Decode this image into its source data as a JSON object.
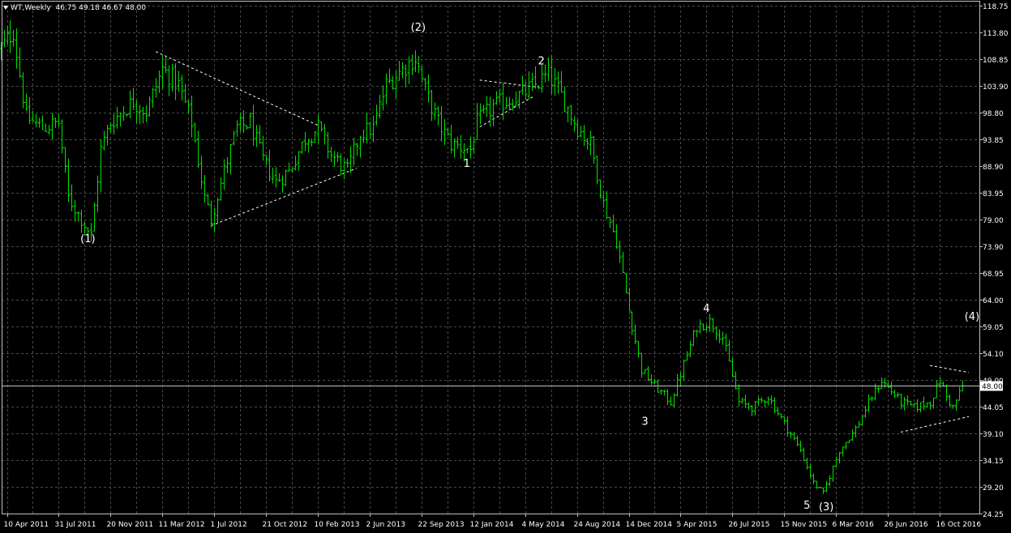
{
  "header": {
    "symbol": "WT,Weekly",
    "ohlc": "46.75 49.18 46.67 48.00"
  },
  "colors": {
    "background": "#000000",
    "grid": "#4a4a4a",
    "bars": "#00e000",
    "price_line": "#c0c0c0",
    "text": "#ffffff"
  },
  "chart_data": {
    "type": "ohlc",
    "title": "WT,Weekly",
    "last_price": 48.0,
    "last_price_label": "48.00",
    "ylim": [
      24.25,
      118.75
    ],
    "y_ticks": [
      "118.75",
      "113.80",
      "108.85",
      "103.90",
      "98.80",
      "93.85",
      "88.90",
      "83.95",
      "79.00",
      "73.90",
      "68.95",
      "64.00",
      "59.05",
      "54.10",
      "49.00",
      "44.05",
      "39.10",
      "34.15",
      "29.20",
      "24.25"
    ],
    "x_ticks": [
      "10 Apr 2011",
      "31 Jul 2011",
      "20 Nov 2011",
      "11 Mar 2012",
      "1 Jul 2012",
      "21 Oct 2012",
      "10 Feb 2013",
      "2 Jun 2013",
      "22 Sep 2013",
      "12 Jan 2014",
      "4 May 2014",
      "24 Aug 2014",
      "14 Dec 2014",
      "5 Apr 2015",
      "26 Jul 2015",
      "15 Nov 2015",
      "6 Mar 2016",
      "26 Jun 2016",
      "16 Oct 2016"
    ],
    "x_dates": [
      "2011-04-10",
      "2011-07-31",
      "2011-11-20",
      "2012-03-11",
      "2012-07-01",
      "2012-10-21",
      "2013-02-10",
      "2013-06-02",
      "2013-09-22",
      "2014-01-12",
      "2014-05-04",
      "2014-08-24",
      "2014-12-14",
      "2015-04-05",
      "2015-07-26",
      "2015-11-15",
      "2016-03-06",
      "2016-06-26",
      "2016-10-16"
    ],
    "price_path": [
      [
        "2011-03-20",
        110
      ],
      [
        "2011-04-24",
        114
      ],
      [
        "2011-05-22",
        98
      ],
      [
        "2011-06-26",
        96
      ],
      [
        "2011-07-31",
        97
      ],
      [
        "2011-08-21",
        83
      ],
      [
        "2011-09-25",
        78
      ],
      [
        "2011-10-09",
        76
      ],
      [
        "2011-10-30",
        92
      ],
      [
        "2011-11-20",
        97
      ],
      [
        "2012-01-08",
        101
      ],
      [
        "2012-02-05",
        99
      ],
      [
        "2012-03-11",
        107
      ],
      [
        "2012-04-15",
        104
      ],
      [
        "2012-05-13",
        97
      ],
      [
        "2012-06-10",
        83
      ],
      [
        "2012-06-24",
        79
      ],
      [
        "2012-07-22",
        88
      ],
      [
        "2012-08-19",
        96
      ],
      [
        "2012-09-16",
        97
      ],
      [
        "2012-10-14",
        90
      ],
      [
        "2012-11-11",
        86
      ],
      [
        "2012-12-09",
        88
      ],
      [
        "2013-01-13",
        94
      ],
      [
        "2013-02-10",
        96
      ],
      [
        "2013-03-10",
        91
      ],
      [
        "2013-04-14",
        88
      ],
      [
        "2013-05-12",
        95
      ],
      [
        "2013-06-09",
        96
      ],
      [
        "2013-07-07",
        104
      ],
      [
        "2013-08-11",
        107
      ],
      [
        "2013-09-08",
        109
      ],
      [
        "2013-09-29",
        103
      ],
      [
        "2013-10-27",
        97
      ],
      [
        "2013-11-24",
        93
      ],
      [
        "2014-01-05",
        92
      ],
      [
        "2014-01-19",
        97
      ],
      [
        "2014-02-23",
        100
      ],
      [
        "2014-03-23",
        101
      ],
      [
        "2014-04-20",
        102
      ],
      [
        "2014-05-25",
        104
      ],
      [
        "2014-06-22",
        106
      ],
      [
        "2014-07-20",
        102
      ],
      [
        "2014-08-24",
        96
      ],
      [
        "2014-09-21",
        93
      ],
      [
        "2014-10-19",
        82
      ],
      [
        "2014-11-16",
        75
      ],
      [
        "2014-12-14",
        62
      ],
      [
        "2015-01-11",
        51
      ],
      [
        "2015-02-08",
        48
      ],
      [
        "2015-03-15",
        45
      ],
      [
        "2015-04-12",
        52
      ],
      [
        "2015-05-10",
        59
      ],
      [
        "2015-06-07",
        60
      ],
      [
        "2015-07-05",
        57
      ],
      [
        "2015-08-09",
        45
      ],
      [
        "2015-09-06",
        44
      ],
      [
        "2015-10-11",
        46
      ],
      [
        "2015-11-15",
        41
      ],
      [
        "2015-12-20",
        36
      ],
      [
        "2016-01-17",
        30
      ],
      [
        "2016-02-07",
        28
      ],
      [
        "2016-03-13",
        36
      ],
      [
        "2016-04-17",
        40
      ],
      [
        "2016-05-22",
        46
      ],
      [
        "2016-06-12",
        49
      ],
      [
        "2016-07-24",
        45
      ],
      [
        "2016-08-21",
        44
      ],
      [
        "2016-09-25",
        45
      ],
      [
        "2016-10-16",
        49
      ],
      [
        "2016-10-30",
        46
      ],
      [
        "2016-11-13",
        44
      ],
      [
        "2016-12-04",
        48
      ]
    ],
    "wave_labels": [
      {
        "text": "(1)",
        "date": "2011-10-02",
        "price": 75.5
      },
      {
        "text": "(2)",
        "date": "2013-09-15",
        "price": 114.8
      },
      {
        "text": "1",
        "date": "2013-12-29",
        "price": 89.5
      },
      {
        "text": "2",
        "date": "2014-06-08",
        "price": 108.6
      },
      {
        "text": "3",
        "date": "2015-01-18",
        "price": 41.5
      },
      {
        "text": "4",
        "date": "2015-05-31",
        "price": 62.5
      },
      {
        "text": "5",
        "date": "2016-01-03",
        "price": 25.9
      },
      {
        "text": "(3)",
        "date": "2016-02-14",
        "price": 25.6
      },
      {
        "text": "(4)",
        "date": "2016-12-25",
        "price": 61.0
      }
    ],
    "trendlines": [
      {
        "from": [
          "2012-02-26",
          110.2
        ],
        "to": [
          "2013-02-10",
          96.5
        ]
      },
      {
        "from": [
          "2012-06-24",
          77.8
        ],
        "to": [
          "2013-05-05",
          88.5
        ]
      },
      {
        "from": [
          "2014-01-26",
          104.9
        ],
        "to": [
          "2014-06-08",
          103.5
        ]
      },
      {
        "from": [
          "2014-01-26",
          96.2
        ],
        "to": [
          "2014-05-25",
          102.0
        ]
      },
      {
        "from": [
          "2016-07-24",
          39.4
        ],
        "to": [
          "2016-12-18",
          42.3
        ]
      },
      {
        "from": [
          "2016-09-25",
          51.8
        ],
        "to": [
          "2016-12-18",
          50.5
        ]
      }
    ]
  }
}
